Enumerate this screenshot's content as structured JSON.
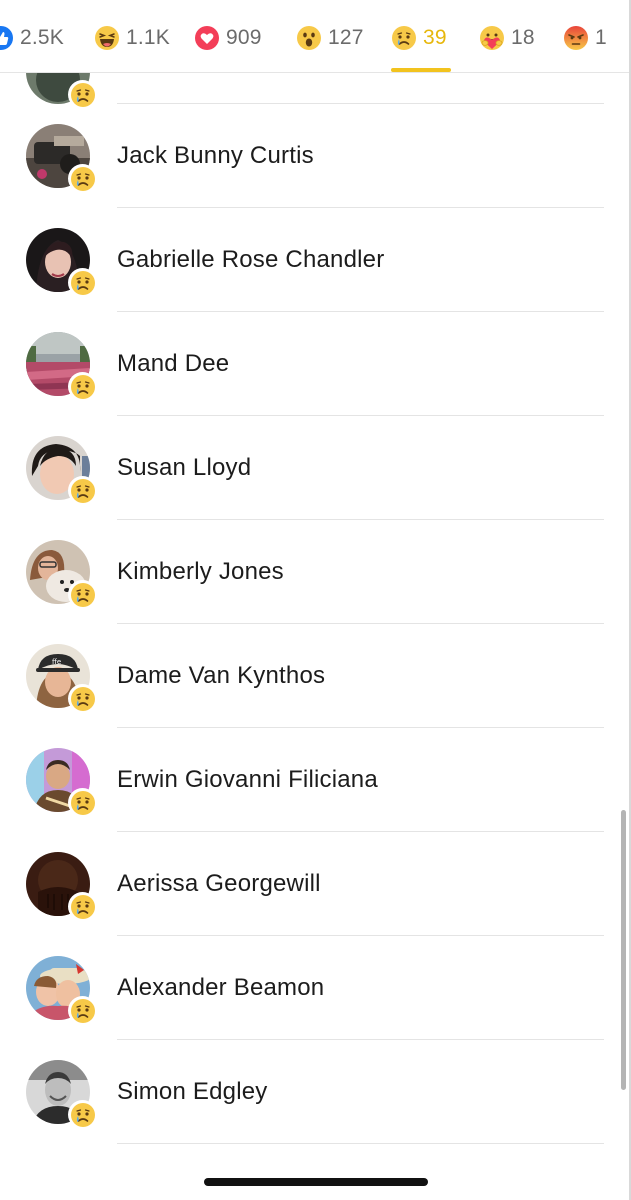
{
  "reaction_tabs": [
    {
      "name": "like",
      "count": "2.5K",
      "active": false
    },
    {
      "name": "haha",
      "count": "1.1K",
      "active": false
    },
    {
      "name": "love",
      "count": "909",
      "active": false
    },
    {
      "name": "wow",
      "count": "127",
      "active": false
    },
    {
      "name": "sad",
      "count": "39",
      "active": true
    },
    {
      "name": "care",
      "count": "18",
      "active": false
    },
    {
      "name": "angry",
      "count": "1",
      "active": false
    }
  ],
  "people": [
    {
      "name": "",
      "reaction": "sad-icon"
    },
    {
      "name": "Jack Bunny Curtis",
      "reaction": "sad-icon"
    },
    {
      "name": "Gabrielle Rose Chandler",
      "reaction": "sad-icon"
    },
    {
      "name": "Mand Dee",
      "reaction": "sad-icon"
    },
    {
      "name": "Susan Lloyd",
      "reaction": "sad-icon"
    },
    {
      "name": "Kimberly Jones",
      "reaction": "sad-icon"
    },
    {
      "name": "Dame Van Kynthos",
      "reaction": "sad-icon"
    },
    {
      "name": "Erwin Giovanni Filiciana",
      "reaction": "sad-icon"
    },
    {
      "name": "Aerissa Georgewill",
      "reaction": "sad-icon"
    },
    {
      "name": "Alexander Beamon",
      "reaction": "sad-icon"
    },
    {
      "name": "Simon Edgley",
      "reaction": "sad-icon"
    }
  ],
  "colors": {
    "active_tab": "#e7b70c",
    "underline": "#f2c31e",
    "like_blue": "#1877f2",
    "love_red": "#f33e58",
    "angry_red": "#e9443a",
    "emoji_yellow": "#f7c948"
  }
}
